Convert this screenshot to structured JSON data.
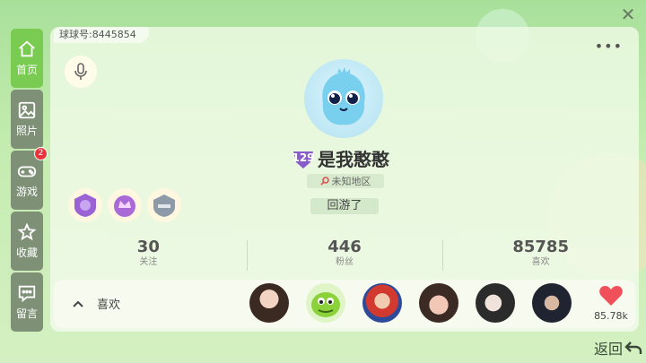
{
  "window": {
    "close_icon": "close-icon",
    "back_label": "返回"
  },
  "sidebar": {
    "items": [
      {
        "label": "首页",
        "icon": "home-icon",
        "active": true
      },
      {
        "label": "照片",
        "icon": "photo-icon"
      },
      {
        "label": "游戏",
        "icon": "gamepad-icon",
        "badge": "2"
      },
      {
        "label": "收藏",
        "icon": "star-icon"
      },
      {
        "label": "留言",
        "icon": "message-icon"
      }
    ]
  },
  "profile": {
    "id_text": "球球号:8445854",
    "level": "129",
    "nickname": "是我憨憨",
    "location": "未知地区",
    "status": "回游了"
  },
  "stats": [
    {
      "value": "30",
      "label": "关注"
    },
    {
      "value": "446",
      "label": "粉丝"
    },
    {
      "value": "85785",
      "label": "喜欢"
    }
  ],
  "likes": {
    "title": "喜欢",
    "total": "85.78k"
  },
  "colors": {
    "accent": "#7acb52",
    "sidebar": "#7e9176",
    "badge": "#e8343a",
    "heart": "#f0505a"
  }
}
